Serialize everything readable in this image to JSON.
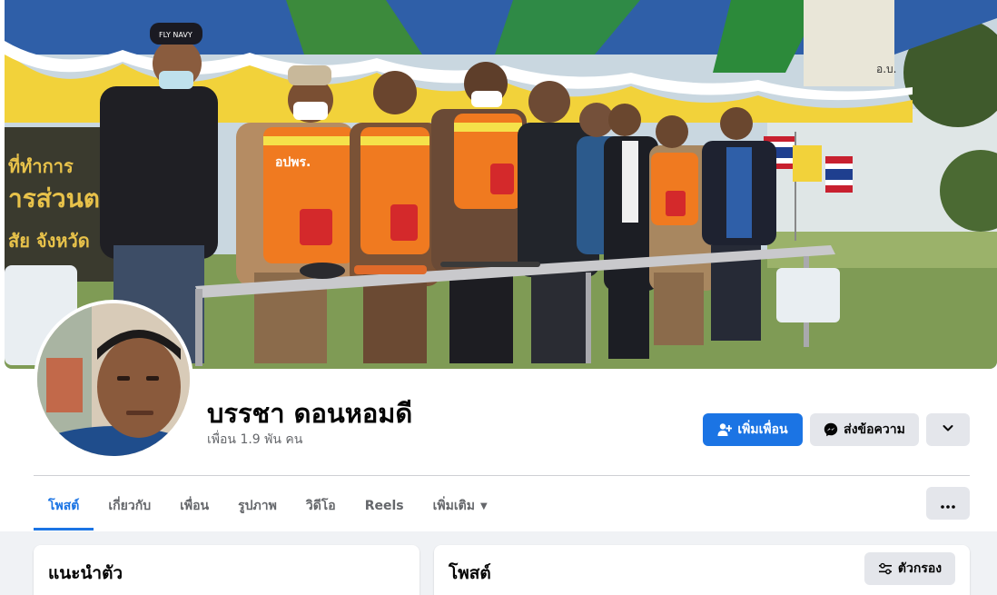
{
  "profile": {
    "name": "บรรชา ดอนหอมดี",
    "friends_count": "เพื่อน 1.9 พัน คน"
  },
  "actions": {
    "add_friend": "เพิ่มเพื่อน",
    "message": "ส่งข้อความ"
  },
  "tabs": [
    {
      "label": "โพสต์",
      "active": true
    },
    {
      "label": "เกี่ยวกับ",
      "active": false
    },
    {
      "label": "เพื่อน",
      "active": false
    },
    {
      "label": "รูปภาพ",
      "active": false
    },
    {
      "label": "วิดีโอ",
      "active": false
    },
    {
      "label": "Reels",
      "active": false
    },
    {
      "label": "เพิ่มเติม",
      "active": false
    }
  ],
  "intro": {
    "title": "แนะนำตัว"
  },
  "posts": {
    "title": "โพสต์",
    "filter_label": "ตัวกรอง"
  },
  "cover_text": {
    "sign_left_1": "ที่ทำการ",
    "sign_left_2": "ารส่วนต",
    "sign_left_3": "สัย  จังหวัด",
    "vest_label": "อปพร.",
    "cap_label": "FLY NAVY",
    "banner_right": "อ.บ."
  },
  "colors": {
    "primary": "#1b74e4",
    "secondary_button": "#e4e6eb",
    "page_background": "#f0f2f5",
    "muted_text": "#65676b"
  },
  "icons": {
    "add_friend": "add-person-icon",
    "message": "messenger-icon",
    "more": "chevron-down-icon",
    "tab_more": "more-dots-icon",
    "filter": "filter-sliders-icon"
  }
}
